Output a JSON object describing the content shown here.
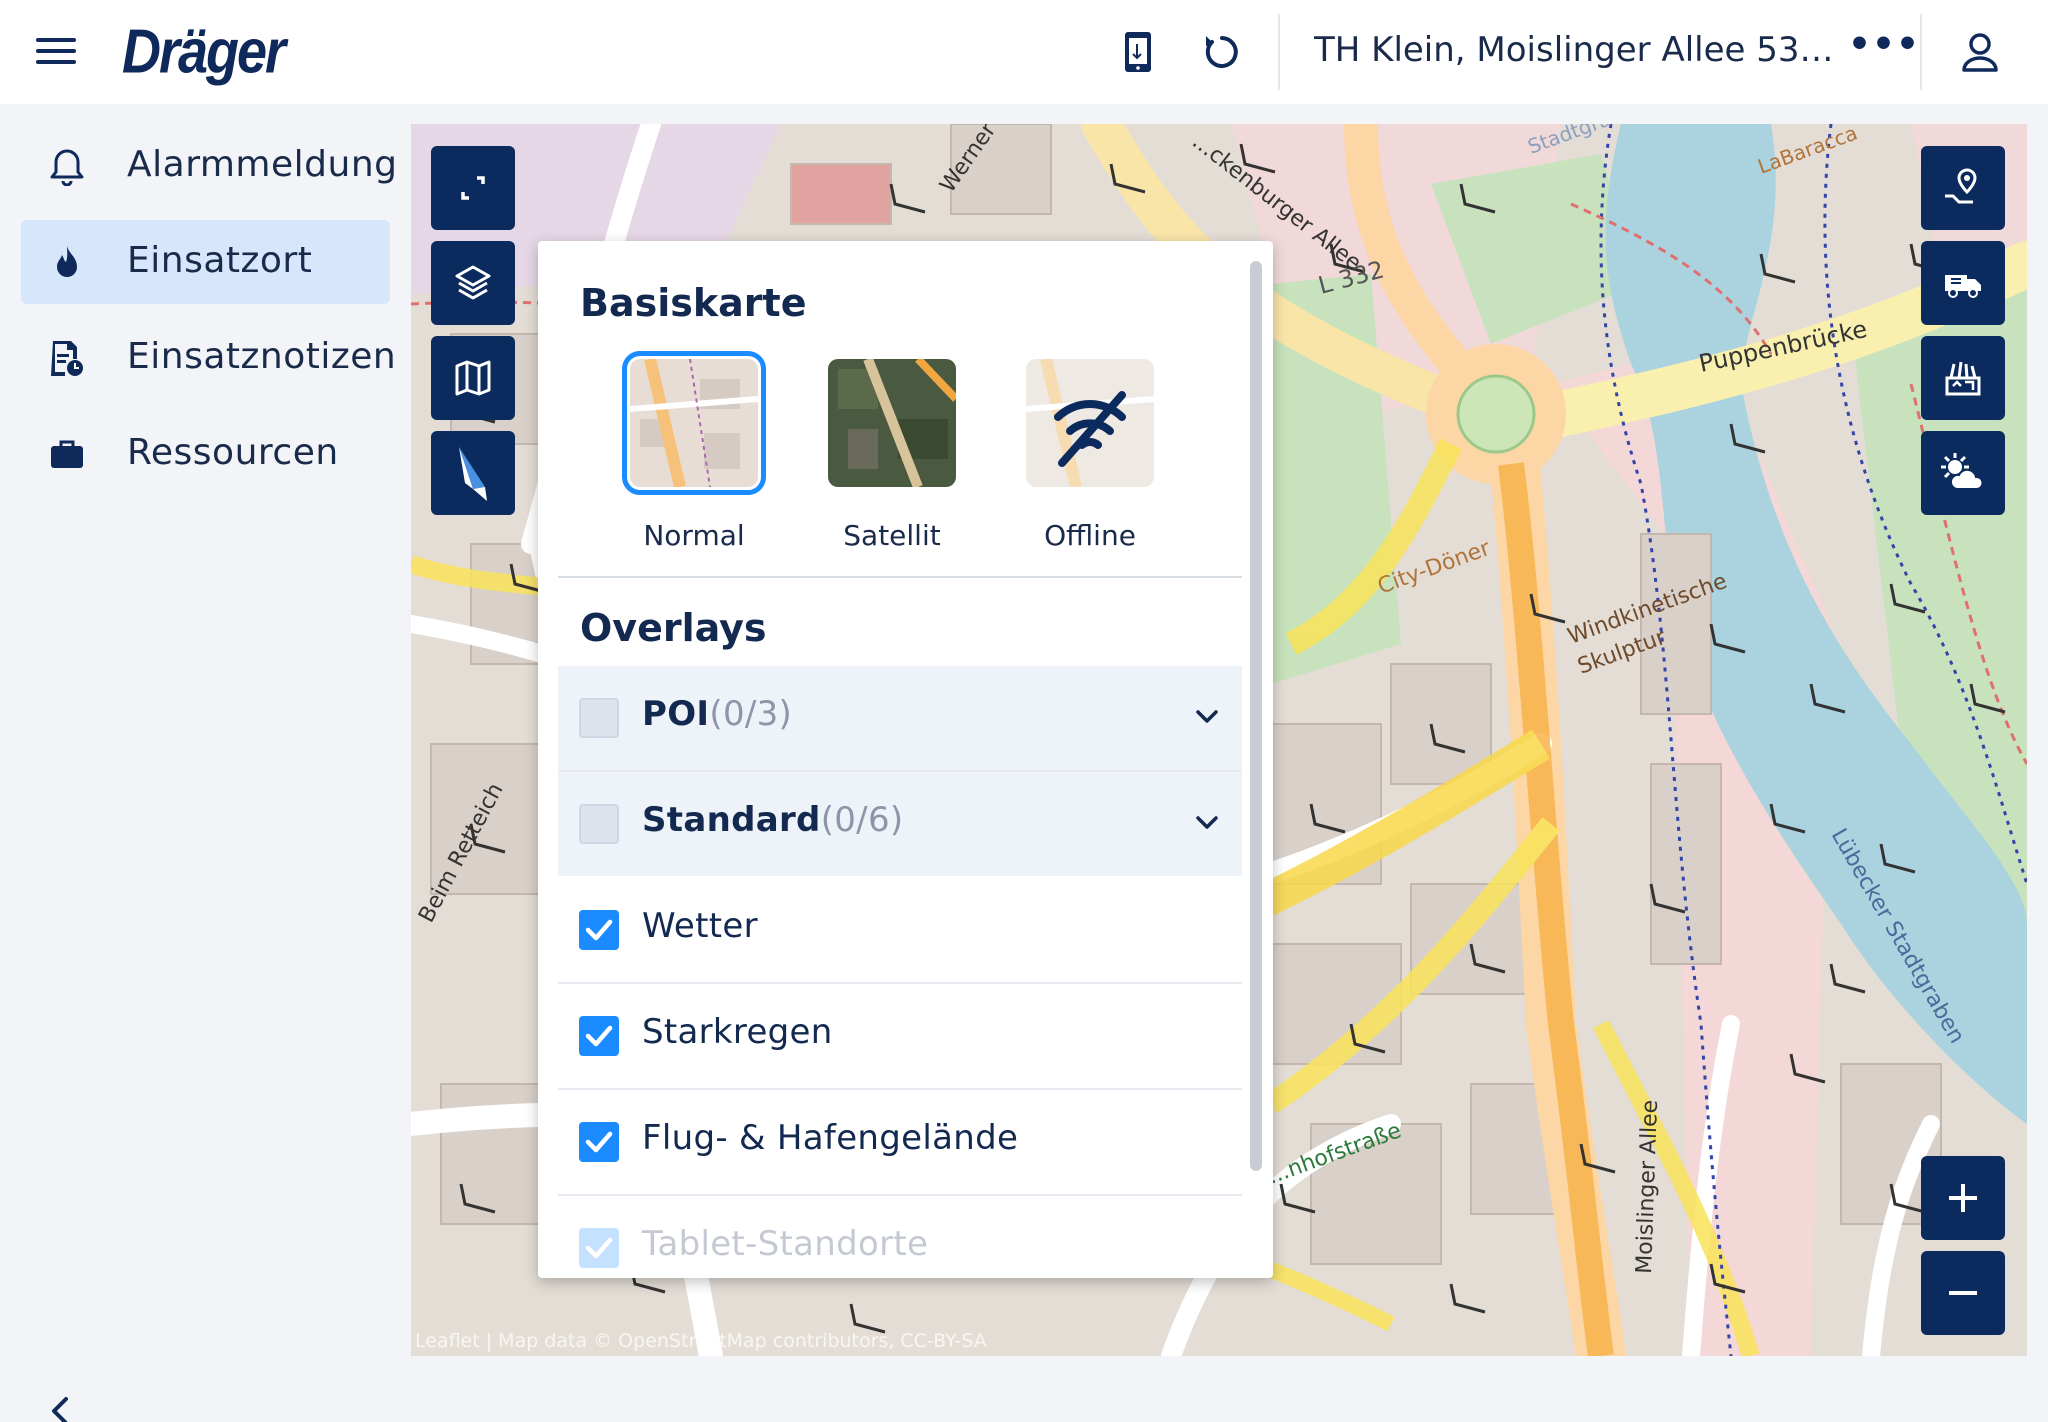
{
  "header": {
    "logo": "Dräger",
    "location": "TH Klein, Moislinger Allee 53-...",
    "more": "•••"
  },
  "sidebar": {
    "items": [
      {
        "label": "Alarmmeldung",
        "icon": "bell-icon",
        "active": false
      },
      {
        "label": "Einsatzort",
        "icon": "flame-icon",
        "active": true
      },
      {
        "label": "Einsatznotizen",
        "icon": "notes-clock-icon",
        "active": false
      },
      {
        "label": "Ressourcen",
        "icon": "briefcase-icon",
        "active": false
      }
    ]
  },
  "map": {
    "labels": {
      "puppenbruecke": "Puppenbrücke",
      "l332": "L 332",
      "city_doener": "City-Döner",
      "windkinetische": "Windkinetische",
      "skulptur": "Skulptur",
      "labaracca": "LaBaracca",
      "stadtgraben": "Lübecker Stadtgraben",
      "moislinger": "Moislinger Allee",
      "ratzeburger": "...ckenburger Allee",
      "beim_retteich": "Beim Retteich",
      "bahnhofstrasse": "...nhofstraße",
      "werner": "Werner",
      "stadtgr_top": "Stadtgra"
    },
    "attribution": "Leaflet | Map data © OpenStreetMap contributors, CC-BY-SA"
  },
  "panel": {
    "basemap_title": "Basiskarte",
    "basemaps": [
      {
        "label": "Normal",
        "selected": true
      },
      {
        "label": "Satellit",
        "selected": false
      },
      {
        "label": "Offline",
        "selected": false
      }
    ],
    "overlays_title": "Overlays",
    "overlays": [
      {
        "label": "POI",
        "count": "(0/3)",
        "checked": false,
        "group": true
      },
      {
        "label": "Standard",
        "count": "(0/6)",
        "checked": false,
        "group": true
      },
      {
        "label": "Wetter",
        "checked": true,
        "group": false
      },
      {
        "label": "Starkregen",
        "checked": true,
        "group": false
      },
      {
        "label": "Flug- & Hafengelände",
        "checked": true,
        "group": false
      },
      {
        "label": "Tablet-Standorte",
        "checked": true,
        "group": false
      }
    ]
  },
  "colors": {
    "navy": "#0b2a5e",
    "accent": "#1a8cff",
    "active_nav": "#d6e6fb"
  }
}
